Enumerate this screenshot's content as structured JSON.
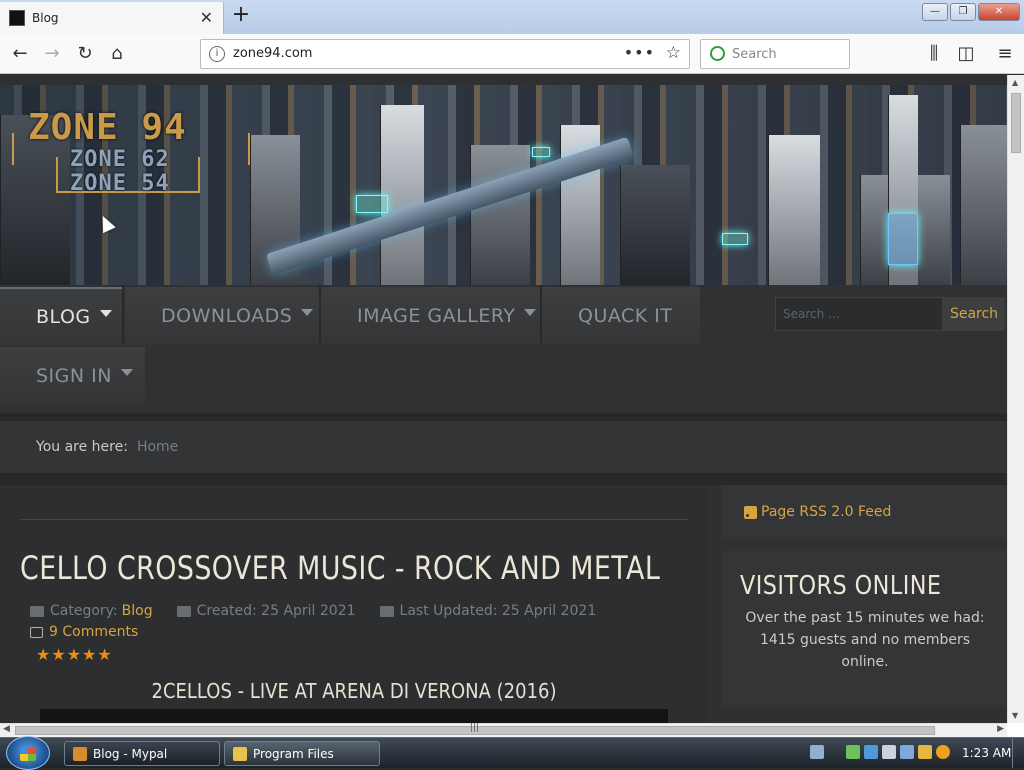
{
  "browser": {
    "tab_title": "Blog",
    "tab_close": "✕",
    "new_tab": "+",
    "url": "zone94.com",
    "url_actions": "•••",
    "search_placeholder": "Search",
    "window_buttons": {
      "minimize": "—",
      "maximize": "❐",
      "close": "✕"
    },
    "icons": [
      "back-icon",
      "forward-icon",
      "reload-icon",
      "home-icon",
      "library-icon",
      "sidebar-icon",
      "menu-icon"
    ]
  },
  "site": {
    "logo": {
      "main": "ZONE 94",
      "line2": "ZONE 62",
      "line3": "ZONE 54"
    },
    "menu": [
      {
        "label": "BLOG",
        "dropdown": true,
        "active": true
      },
      {
        "label": "DOWNLOADS",
        "dropdown": true
      },
      {
        "label": "IMAGE GALLERY",
        "dropdown": true
      },
      {
        "label": "QUACK IT",
        "dropdown": false
      },
      {
        "label": "SIGN IN",
        "dropdown": true
      }
    ],
    "search": {
      "placeholder": "Search ...",
      "button": "Search"
    },
    "breadcrumb": {
      "label": "You are here:",
      "home": "Home"
    },
    "colors": {
      "accent": "#d7a444",
      "stars": "#f08a18",
      "bg": "#2e3032"
    }
  },
  "article": {
    "title": "CELLO CROSSOVER MUSIC - ROCK AND METAL",
    "category_label": "Category:",
    "category": "Blog",
    "created": "Created: 25 April 2021",
    "updated": "Last Updated: 25 April 2021",
    "comments": "9 Comments",
    "rating_stars": "★★★★★",
    "rating": 5,
    "subtitle": "2CELLOS - LIVE AT ARENA DI VERONA (2016)"
  },
  "sidebar": {
    "rss": "Page RSS 2.0 Feed",
    "visitors_title": "VISITORS ONLINE",
    "visitors_text": "Over the past 15 minutes we had: 1415 guests and no members online."
  },
  "taskbar": {
    "tasks": [
      "Blog - Mypal",
      "Program Files"
    ],
    "clock": "1:23 AM"
  }
}
